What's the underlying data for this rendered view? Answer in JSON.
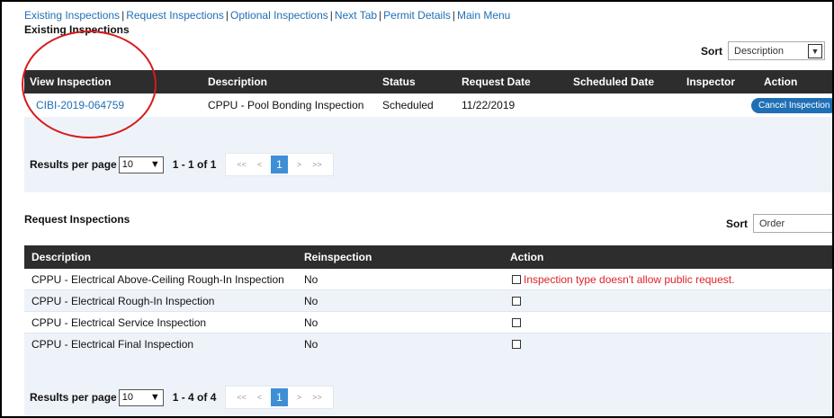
{
  "nav": {
    "links": [
      "Existing Inspections",
      "Request Inspections",
      "Optional Inspections",
      "Next Tab",
      "Permit Details",
      "Main Menu"
    ],
    "separator": "|"
  },
  "existing": {
    "title": "Existing Inspections",
    "sort_label": "Sort",
    "sort_value": "Description",
    "headers": [
      "View Inspection",
      "Description",
      "Status",
      "Request Date",
      "Scheduled Date",
      "Inspector",
      "Action"
    ],
    "rows": [
      {
        "id": "CIBI-2019-064759",
        "description": "CPPU - Pool Bonding Inspection",
        "status": "Scheduled",
        "request_date": "11/22/2019",
        "scheduled_date": "",
        "inspector": "",
        "action": "Cancel Inspection"
      }
    ],
    "pager": {
      "label": "Results per page",
      "per_page": "10",
      "range": "1 - 1 of 1",
      "first": "<<",
      "prev": "<",
      "current": "1",
      "next": ">",
      "last": ">>"
    }
  },
  "request": {
    "title": "Request Inspections",
    "sort_label": "Sort",
    "sort_value": "Order",
    "headers": [
      "Description",
      "Reinspection",
      "Action"
    ],
    "rows": [
      {
        "description": "CPPU - Electrical Above-Ceiling Rough-In Inspection",
        "reinspection": "No",
        "note": "Inspection type doesn't allow public request."
      },
      {
        "description": "CPPU - Electrical Rough-In Inspection",
        "reinspection": "No",
        "note": ""
      },
      {
        "description": "CPPU - Electrical Service Inspection",
        "reinspection": "No",
        "note": ""
      },
      {
        "description": "CPPU - Electrical Final Inspection",
        "reinspection": "No",
        "note": ""
      }
    ],
    "pager": {
      "label": "Results per page",
      "per_page": "10",
      "range": "1 - 4 of 4",
      "first": "<<",
      "prev": "<",
      "current": "1",
      "next": ">",
      "last": ">>"
    }
  },
  "colors": {
    "link": "#1f6fb5",
    "header_bg": "#2d2d2d",
    "panel_bg": "#eef3f9",
    "warning": "#e0212b",
    "annotation": "#d61b1b"
  },
  "icons": {
    "dropdown": "chevron-down-icon",
    "checkbox": "checkbox-icon"
  }
}
